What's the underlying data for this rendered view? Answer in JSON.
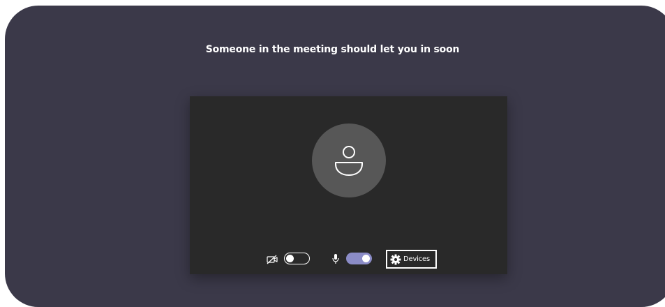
{
  "lobby": {
    "message": "Someone in the meeting should let you in soon"
  },
  "controls": {
    "camera_icon": "camera-off-icon",
    "camera_enabled": false,
    "mic_icon": "microphone-icon",
    "mic_enabled": true,
    "devices_icon": "gear-icon",
    "devices_label": "Devices"
  },
  "colors": {
    "background": "#3b3949",
    "preview": "#292929",
    "avatar": "#575757",
    "toggle_on": "#8b8cc7"
  }
}
